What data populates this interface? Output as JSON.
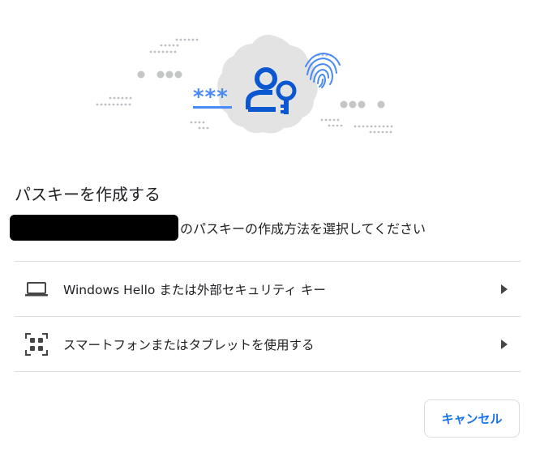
{
  "dialog": {
    "title": "パスキーを作成する",
    "subtitle_suffix": "のパスキーの作成方法を選択してください"
  },
  "options": [
    {
      "label": "Windows Hello または外部セキュリティ キー",
      "icon": "laptop-icon"
    },
    {
      "label": "スマートフォンまたはタブレットを使用する",
      "icon": "qr-code-icon"
    }
  ],
  "buttons": {
    "cancel": "キャンセル"
  },
  "illustration": {
    "password_mask": "***"
  },
  "colors": {
    "accent": "#1a73e8",
    "hero_blue": "#0b57d0",
    "badge_gray": "#e3e3e3"
  }
}
